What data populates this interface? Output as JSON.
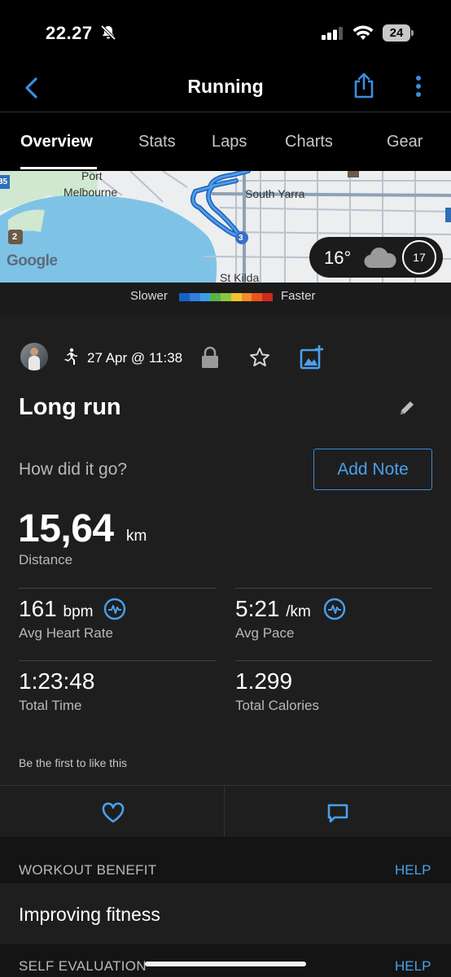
{
  "status": {
    "time": "22.27",
    "battery": "24"
  },
  "nav": {
    "title": "Running"
  },
  "tabs": [
    "Overview",
    "Stats",
    "Laps",
    "Charts",
    "Gear"
  ],
  "map": {
    "labels": {
      "port_melbourne": "Port\nMelbourne",
      "south_yarra": "South Yarra",
      "st_kilda": "St Kilda",
      "google": "Google",
      "route_35": "35",
      "route_2": "2",
      "route_3": "3"
    },
    "weather": {
      "temperature": "16°",
      "icon": "cloud-icon",
      "wind": "17"
    }
  },
  "legend": {
    "slower": "Slower",
    "faster": "Faster",
    "colors": [
      "#1560c8",
      "#2f7fe0",
      "#3aa0e6",
      "#5ab24a",
      "#8cc63f",
      "#f2c230",
      "#f28c28",
      "#e8541e",
      "#d02a1e"
    ]
  },
  "activity": {
    "date": "27 Apr @ 11:38",
    "title": "Long run",
    "prompt": "How did it go?",
    "add_note": "Add Note",
    "distance": {
      "value": "15,64",
      "unit": "km",
      "label": "Distance"
    },
    "stats": [
      {
        "value": "161",
        "unit": "bpm",
        "label": "Avg Heart Rate",
        "icon": "pulse-icon"
      },
      {
        "value": "5:21",
        "unit": "/km",
        "label": "Avg Pace",
        "icon": "pulse-icon"
      },
      {
        "value": "1:23:48",
        "unit": "",
        "label": "Total Time"
      },
      {
        "value": "1.299",
        "unit": "",
        "label": "Total Calories"
      }
    ],
    "likes_text": "Be the first to like this"
  },
  "workout_benefit": {
    "title": "WORKOUT BENEFIT",
    "help": "HELP",
    "value": "Improving fitness"
  },
  "self_evaluation": {
    "title": "SELF EVALUATION",
    "help": "HELP"
  },
  "colors": {
    "accent": "#4aa0ee",
    "background": "#1e1e1e"
  }
}
